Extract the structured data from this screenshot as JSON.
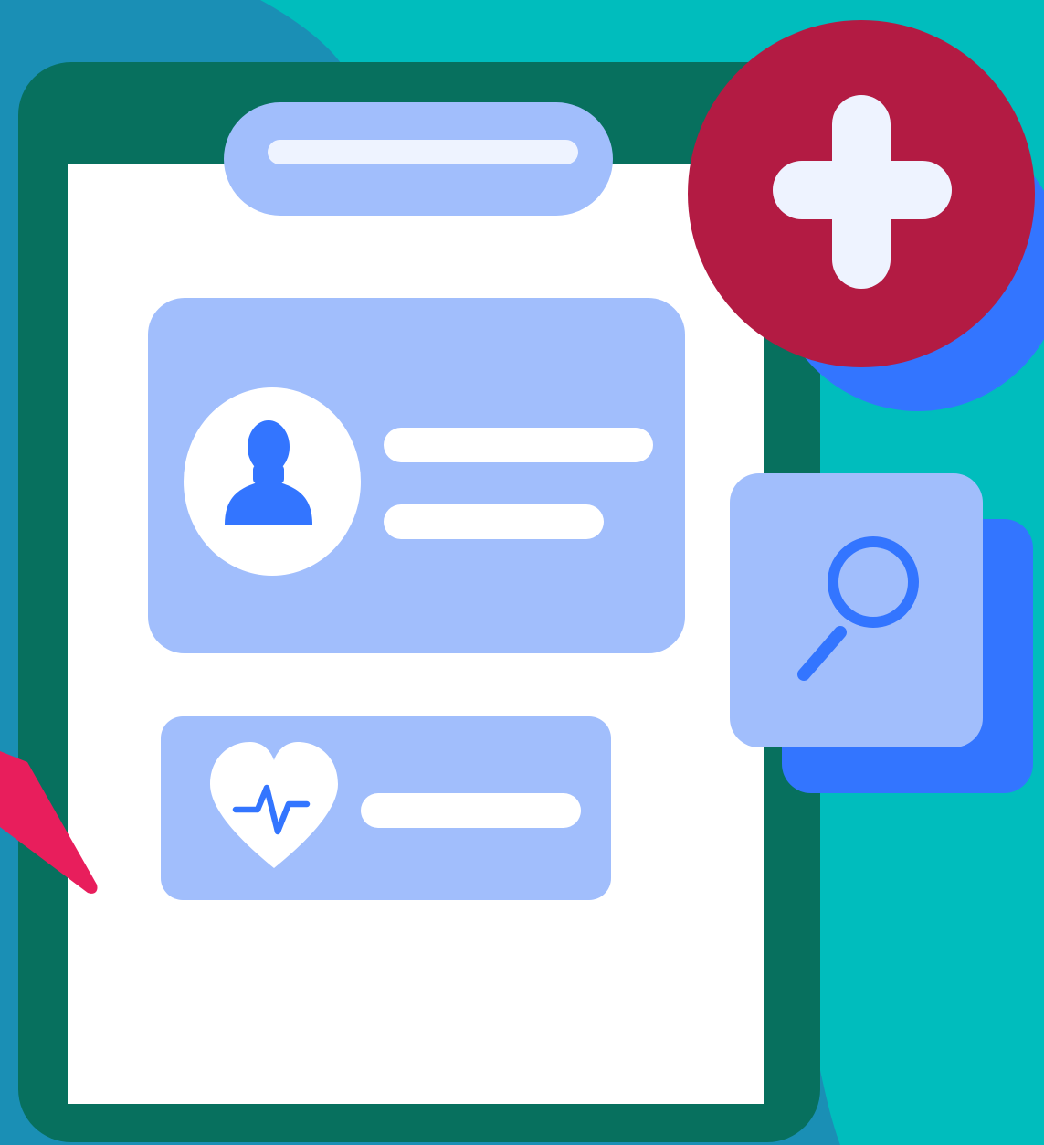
{
  "colors": {
    "background_teal": "#00BDBD",
    "background_blue": "#1A8FB5",
    "clipboard_board": "#07705E",
    "paper": "#FFFFFF",
    "card_fill": "#A1BEFC",
    "card_line": "#FFFFFF",
    "clip_bar": "#EEF3FF",
    "accent_blue": "#3375FF",
    "cross_circle": "#B31B43",
    "cross": "#EEF3FF",
    "pen": "#E81E5C",
    "pulse_line": "#3375FF"
  },
  "icons": {
    "patient_avatar": "person-icon",
    "vitals": "heart-pulse-icon",
    "search": "magnifier-icon",
    "medical": "medical-cross-icon",
    "pen": "pen-icon"
  }
}
